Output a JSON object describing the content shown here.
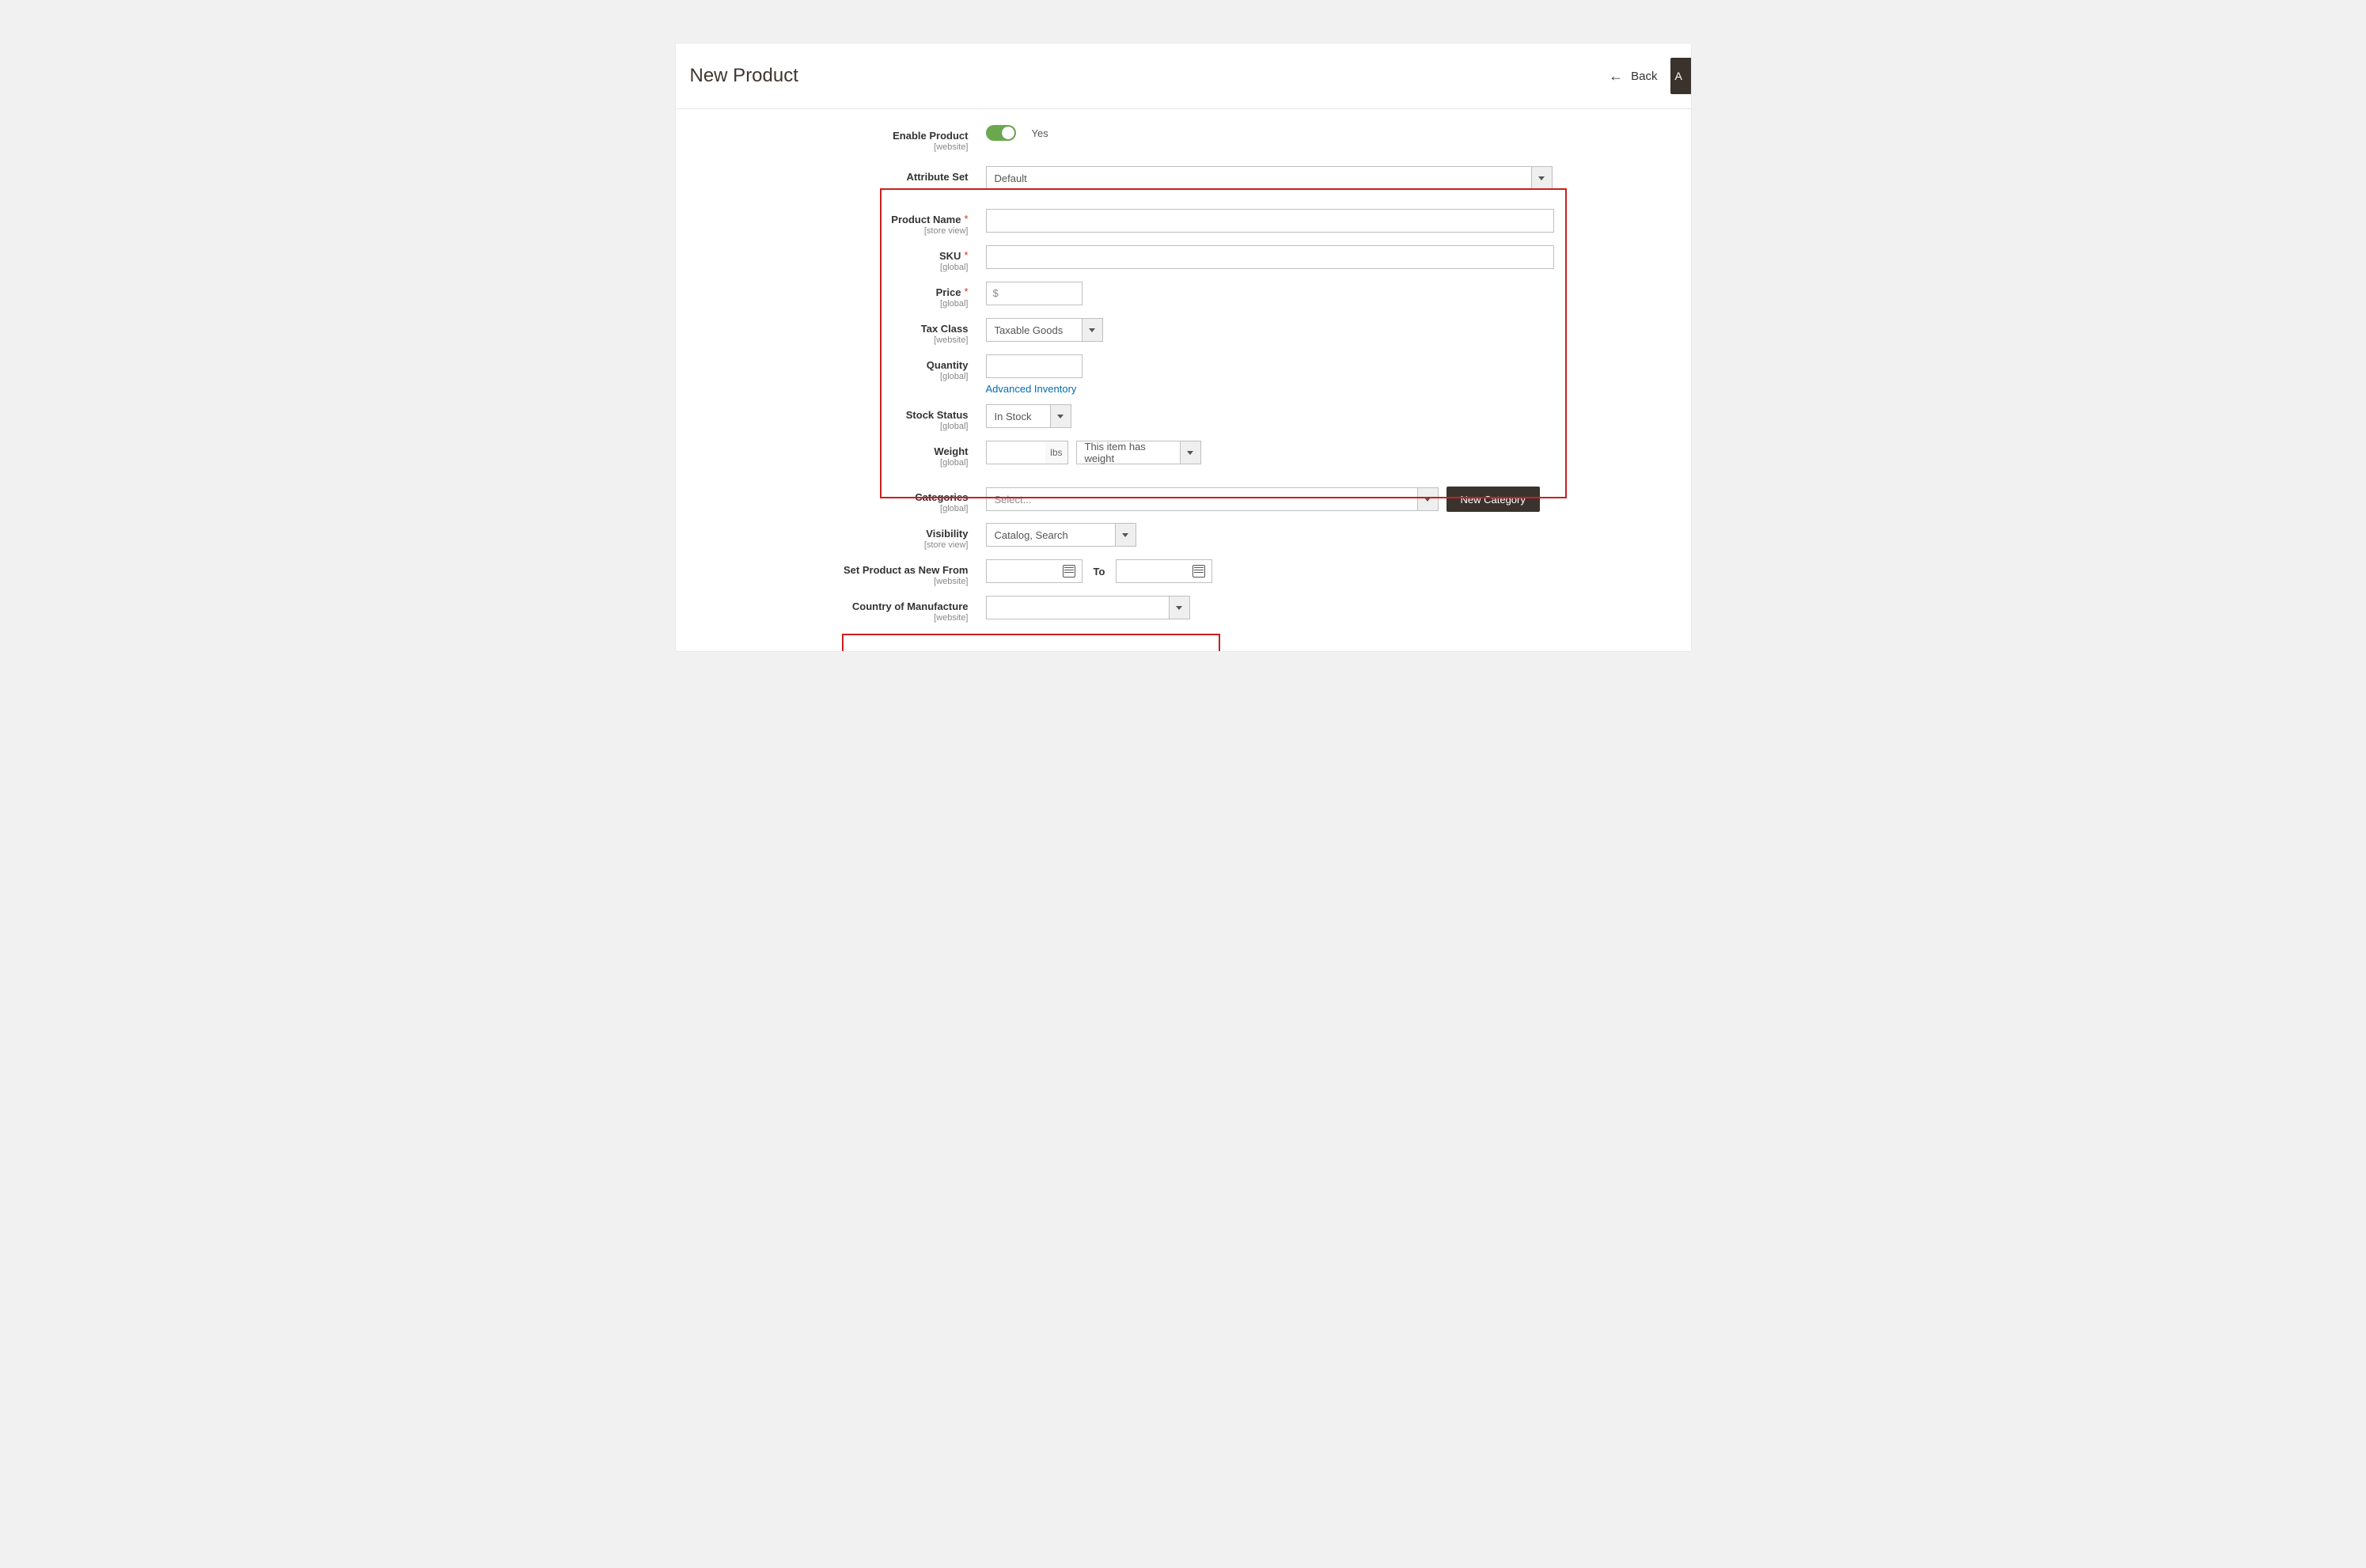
{
  "header": {
    "title": "New Product",
    "back_label": "Back",
    "save_edge_label": "A"
  },
  "fields": {
    "enable_product": {
      "label": "Enable Product",
      "scope": "[website]",
      "value": "Yes"
    },
    "attribute_set": {
      "label": "Attribute Set",
      "value": "Default"
    },
    "product_name": {
      "label": "Product Name",
      "scope": "[store view]",
      "value": ""
    },
    "sku": {
      "label": "SKU",
      "scope": "[global]",
      "value": ""
    },
    "price": {
      "label": "Price",
      "scope": "[global]",
      "currency": "$",
      "value": ""
    },
    "tax_class": {
      "label": "Tax Class",
      "scope": "[website]",
      "value": "Taxable Goods"
    },
    "quantity": {
      "label": "Quantity",
      "scope": "[global]",
      "value": "",
      "advanced_link": "Advanced Inventory"
    },
    "stock_status": {
      "label": "Stock Status",
      "scope": "[global]",
      "value": "In Stock"
    },
    "weight": {
      "label": "Weight",
      "scope": "[global]",
      "unit": "lbs",
      "value": "",
      "type_value": "This item has weight"
    },
    "categories": {
      "label": "Categories",
      "scope": "[global]",
      "placeholder": "Select...",
      "new_category_btn": "New Category"
    },
    "visibility": {
      "label": "Visibility",
      "scope": "[store view]",
      "value": "Catalog, Search"
    },
    "set_new_from": {
      "label": "Set Product as New From",
      "scope": "[website]",
      "to_label": "To",
      "from_value": "",
      "to_value": ""
    },
    "country": {
      "label": "Country of Manufacture",
      "scope": "[website]",
      "value": ""
    }
  }
}
